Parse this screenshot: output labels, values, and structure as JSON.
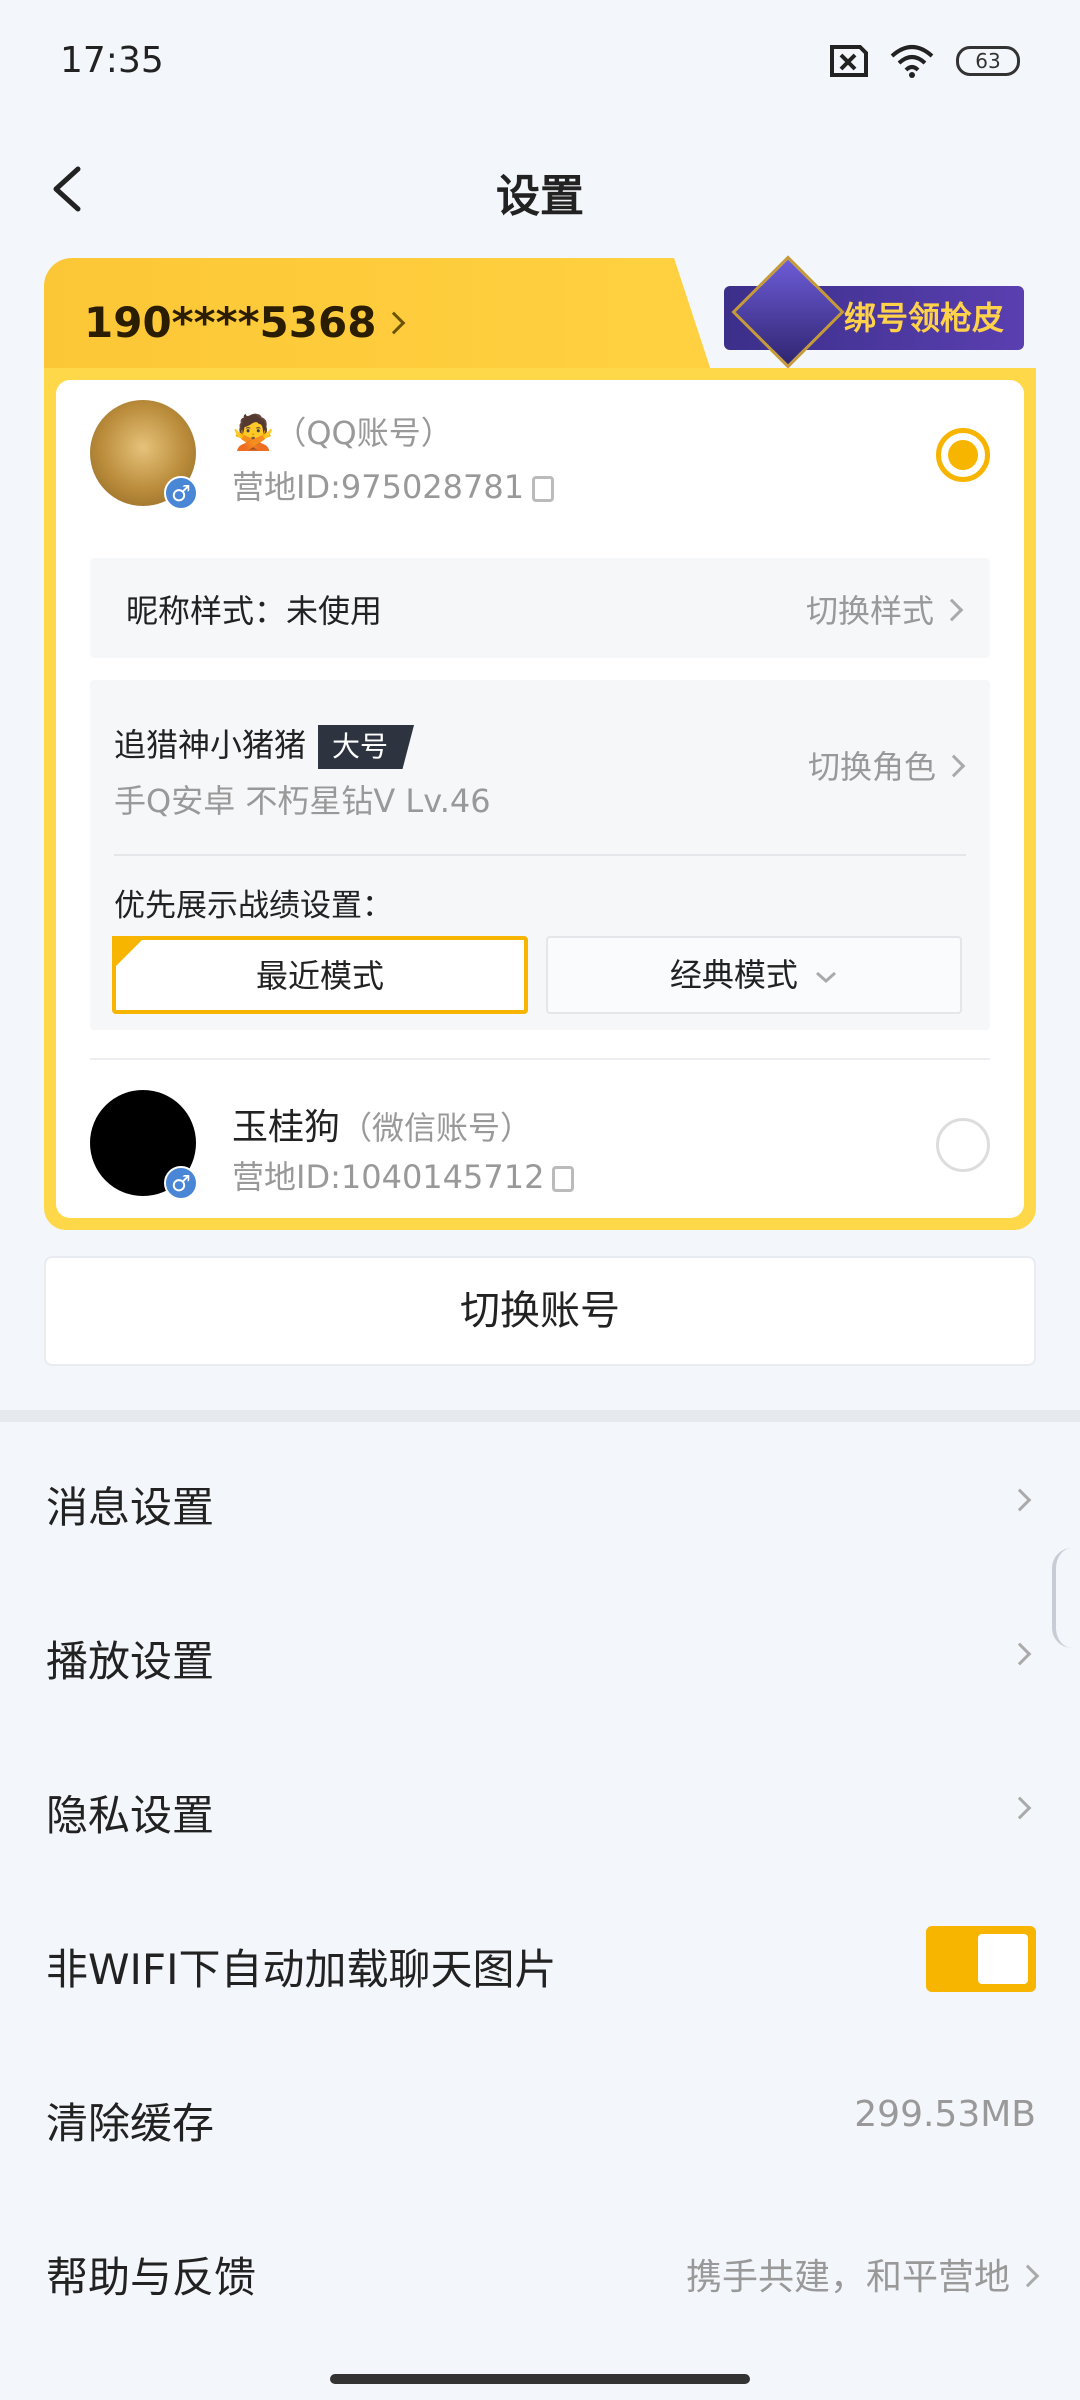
{
  "status_bar": {
    "time": "17:35",
    "battery": "63"
  },
  "nav": {
    "title": "设置"
  },
  "account_card": {
    "phone": "190****5368",
    "promo_label": "绑号领枪皮",
    "qq_account": {
      "emoji": "🙅",
      "type": "（QQ账号）",
      "id_text": "营地ID:975028781",
      "selected": true
    },
    "nickname": {
      "label": "昵称样式：未使用",
      "action": "切换样式"
    },
    "role": {
      "name": "追猎神小猪猪",
      "badge": "大号",
      "meta": "手Q安卓   不朽星钻Ⅴ   Lv.46",
      "switch_label": "切换角色",
      "pref_label": "优先展示战绩设置：",
      "mode_recent": "最近模式",
      "mode_classic": "经典模式"
    },
    "wx_account": {
      "name": "玉桂狗",
      "type": "（微信账号）",
      "id_text": "营地ID:1040145712",
      "selected": false
    }
  },
  "switch_account_label": "切换账号",
  "settings": {
    "message": "消息设置",
    "playback": "播放设置",
    "privacy": "隐私设置",
    "auto_load": "非WIFI下自动加载聊天图片",
    "auto_load_on": true,
    "clear_cache": "清除缓存",
    "cache_size": "299.53MB",
    "help": "帮助与反馈",
    "help_value": "携手共建，和平营地"
  },
  "colors": {
    "accent": "#f7b500",
    "card_yellow": "#ffd84a",
    "promo_purple": "#3b2f8a"
  }
}
